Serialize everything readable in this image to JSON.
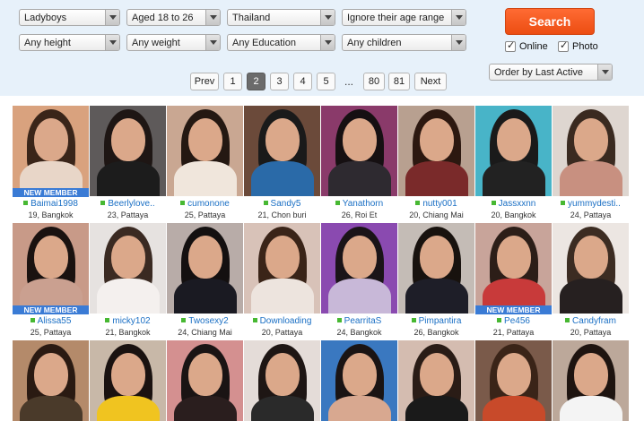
{
  "filters": {
    "row1": [
      "Ladyboys",
      "Aged 18 to 26",
      "Thailand",
      "Ignore their age range"
    ],
    "row2": [
      "Any height",
      "Any weight",
      "Any Education",
      "Any children"
    ],
    "search_label": "Search",
    "online_label": "Online",
    "online_checked": true,
    "photo_label": "Photo",
    "photo_checked": true,
    "order_label": "Order by Last Active"
  },
  "pagination": {
    "prev": "Prev",
    "pages": [
      "1",
      "2",
      "3",
      "4",
      "5"
    ],
    "current": "2",
    "ellipsis": "...",
    "last_pages": [
      "80",
      "81"
    ],
    "next": "Next"
  },
  "profiles": [
    {
      "name": "Baimai1998",
      "meta": "19, Bangkok",
      "badge": "NEW MEMBER",
      "bg": "#d9a27e",
      "hair": "#3a2519",
      "top": "#e8d6c8"
    },
    {
      "name": "Beerlylove..",
      "meta": "23, Pattaya",
      "badge": "",
      "bg": "#5e5a5a",
      "hair": "#1e1614",
      "top": "#1c1c1c"
    },
    {
      "name": "cumonone",
      "meta": "25, Pattaya",
      "badge": "",
      "bg": "#c9a792",
      "hair": "#241812",
      "top": "#f0e6dc"
    },
    {
      "name": "Sandy5",
      "meta": "21, Chon buri",
      "badge": "",
      "bg": "#6b4a3a",
      "hair": "#1a1a1a",
      "top": "#2a6aa8"
    },
    {
      "name": "Yanathorn",
      "meta": "26, Roi Et",
      "badge": "",
      "bg": "#8a3a6a",
      "hair": "#161012",
      "top": "#2e2a30"
    },
    {
      "name": "nutty001",
      "meta": "20, Chiang Mai",
      "badge": "",
      "bg": "#b8a090",
      "hair": "#2c1810",
      "top": "#7a2a2a"
    },
    {
      "name": "Jassxxnn",
      "meta": "20, Bangkok",
      "badge": "",
      "bg": "#48b4c8",
      "hair": "#1a1a1a",
      "top": "#222222"
    },
    {
      "name": "yummydesti..",
      "meta": "24, Pattaya",
      "badge": "",
      "bg": "#ded6d0",
      "hair": "#3a2a20",
      "top": "#c89080"
    },
    {
      "name": "Alissa55",
      "meta": "25, Pattaya",
      "badge": "NEW MEMBER",
      "bg": "#c89a88",
      "hair": "#1a1210",
      "top": "#caa090"
    },
    {
      "name": "micky102",
      "meta": "21, Bangkok",
      "badge": "",
      "bg": "#e6e2e0",
      "hair": "#3a2a22",
      "top": "#f4f0ee"
    },
    {
      "name": "Twosexy2",
      "meta": "24, Chiang Mai",
      "badge": "",
      "bg": "#b8aca8",
      "hair": "#141010",
      "top": "#1a1a22"
    },
    {
      "name": "Downloading",
      "meta": "20, Pattaya",
      "badge": "",
      "bg": "#d8c2b8",
      "hair": "#3a2418",
      "top": "#ede4de"
    },
    {
      "name": "PearritaS",
      "meta": "24, Bangkok",
      "badge": "",
      "bg": "#8a4ab0",
      "hair": "#1a1418",
      "top": "#c8b8d8"
    },
    {
      "name": "Pimpantira",
      "meta": "26, Bangkok",
      "badge": "",
      "bg": "#c4bcb6",
      "hair": "#18120e",
      "top": "#1e1e28"
    },
    {
      "name": "Pe456",
      "meta": "21, Pattaya",
      "badge": "NEW MEMBER",
      "bg": "#c8a49a",
      "hair": "#2c1e18",
      "top": "#c83a3a"
    },
    {
      "name": "Candyfram",
      "meta": "20, Pattaya",
      "badge": "",
      "bg": "#ece6e2",
      "hair": "#3c2c22",
      "top": "#262020"
    },
    {
      "name": "",
      "meta": "",
      "badge": "",
      "bg": "#b48a6a",
      "hair": "#2a1a12",
      "top": "#4a3a2a"
    },
    {
      "name": "",
      "meta": "",
      "badge": "",
      "bg": "#c8b8a8",
      "hair": "#1a1210",
      "top": "#f0c420"
    },
    {
      "name": "",
      "meta": "",
      "badge": "",
      "bg": "#d49090",
      "hair": "#1a1414",
      "top": "#2a1e1e"
    },
    {
      "name": "",
      "meta": "",
      "badge": "",
      "bg": "#e4dcd8",
      "hair": "#1e1614",
      "top": "#2a2a2a"
    },
    {
      "name": "",
      "meta": "",
      "badge": "",
      "bg": "#3a78c0",
      "hair": "#1a1414",
      "top": "#d8a890"
    },
    {
      "name": "",
      "meta": "",
      "badge": "",
      "bg": "#d4bcb0",
      "hair": "#2a1c16",
      "top": "#1a1a1a"
    },
    {
      "name": "",
      "meta": "",
      "badge": "",
      "bg": "#7a5a4a",
      "hair": "#3a2418",
      "top": "#c84a2a"
    },
    {
      "name": "",
      "meta": "",
      "badge": "",
      "bg": "#bca89a",
      "hair": "#1e1410",
      "top": "#f4f4f4"
    }
  ]
}
